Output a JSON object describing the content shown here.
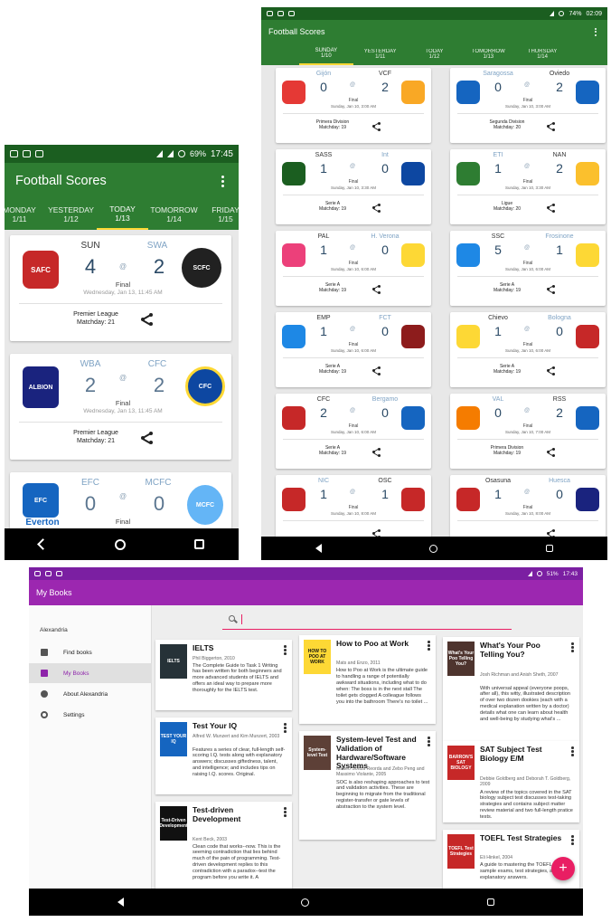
{
  "phone": {
    "status": {
      "percent": "69%",
      "time": "17:45"
    },
    "title": "Football Scores",
    "tabs": [
      {
        "day": "MONDAY",
        "date": "1/11"
      },
      {
        "day": "YESTERDAY",
        "date": "1/12"
      },
      {
        "day": "TODAY",
        "date": "1/13"
      },
      {
        "day": "TOMORROW",
        "date": "1/14"
      },
      {
        "day": "FRIDAY",
        "date": "1/15"
      }
    ],
    "matches": [
      {
        "home": "SUN",
        "away": "SWA",
        "home_score": "4",
        "away_score": "2",
        "at": "@",
        "status": "Final",
        "datetime": "Wednesday, Jan 13, 11:45 AM",
        "league": "Premier League",
        "matchday": "Matchday: 21",
        "home_color": "#c62828",
        "away_color": "#212121",
        "home_crest": "sunderland-crest",
        "away_crest": "swansea-crest"
      },
      {
        "home": "WBA",
        "away": "CFC",
        "home_score": "2",
        "away_score": "2",
        "at": "@",
        "status": "Final",
        "datetime": "Wednesday, Jan 13, 11:45 AM",
        "league": "Premier League",
        "matchday": "Matchday: 21",
        "home_color": "#1a237e",
        "away_color": "#0d47a1",
        "home_crest": "west-brom-crest",
        "away_crest": "chelsea-crest"
      },
      {
        "home": "EFC",
        "away": "MCFC",
        "home_score": "0",
        "away_score": "0",
        "at": "@",
        "status": "Final",
        "datetime": "",
        "league": "",
        "matchday": "",
        "home_color": "#1565c0",
        "away_color": "#64b5f6",
        "home_crest": "everton-crest",
        "away_crest": "man-city-crest",
        "home_label": "Everton"
      }
    ]
  },
  "tablet": {
    "status": {
      "percent": "74%",
      "time": "02:09"
    },
    "title": "Football Scores",
    "tabs": [
      {
        "day": "SUNDAY",
        "date": "1/10"
      },
      {
        "day": "YESTERDAY",
        "date": "1/11"
      },
      {
        "day": "TODAY",
        "date": "1/12"
      },
      {
        "day": "TOMORROW",
        "date": "1/13"
      },
      {
        "day": "THURSDAY",
        "date": "1/14"
      }
    ],
    "matches": [
      {
        "home": "Gijón",
        "away": "VCF",
        "home_score": "0",
        "away_score": "2",
        "status": "Final",
        "datetime": "Sunday, Jan 10, 3:00 AM",
        "league": "Primera Division",
        "matchday": "Matchday: 19",
        "home_color": "#e53935",
        "away_color": "#f9a825",
        "home_win": false
      },
      {
        "home": "Saragossa",
        "away": "Oviedo",
        "home_score": "0",
        "away_score": "2",
        "status": "Final",
        "datetime": "Sunday, Jan 10, 3:00 AM",
        "league": "Segunda Division",
        "matchday": "Matchday: 20",
        "home_color": "#1565c0",
        "away_color": "#1565c0",
        "home_win": false
      },
      {
        "home": "SASS",
        "away": "Int",
        "home_score": "1",
        "away_score": "0",
        "status": "Final",
        "datetime": "Sunday, Jan 10, 3:30 AM",
        "league": "Serie A",
        "matchday": "Matchday: 19",
        "home_color": "#1b5e20",
        "away_color": "#0d47a1",
        "home_win": true
      },
      {
        "home": "ETI",
        "away": "NAN",
        "home_score": "1",
        "away_score": "2",
        "status": "Final",
        "datetime": "Sunday, Jan 10, 3:30 AM",
        "league": "Ligue",
        "matchday": "Matchday: 20",
        "home_color": "#2e7d32",
        "away_color": "#fbc02d",
        "home_win": false
      },
      {
        "home": "PAL",
        "away": "H. Verona",
        "home_score": "1",
        "away_score": "0",
        "status": "Final",
        "datetime": "Sunday, Jan 10, 6:00 AM",
        "league": "Serie A",
        "matchday": "Matchday: 19",
        "home_color": "#ec407a",
        "away_color": "#fdd835",
        "home_win": true
      },
      {
        "home": "SSC",
        "away": "Frosinone",
        "home_score": "5",
        "away_score": "1",
        "status": "Final",
        "datetime": "Sunday, Jan 10, 6:00 AM",
        "league": "Serie A",
        "matchday": "Matchday: 19",
        "home_color": "#1e88e5",
        "away_color": "#fdd835",
        "home_win": true
      },
      {
        "home": "EMP",
        "away": "FCT",
        "home_score": "1",
        "away_score": "0",
        "status": "Final",
        "datetime": "Sunday, Jan 10, 6:00 AM",
        "league": "Serie A",
        "matchday": "Matchday: 19",
        "home_color": "#1e88e5",
        "away_color": "#8d1c1c",
        "home_win": true
      },
      {
        "home": "Chievo",
        "away": "Bologna",
        "home_score": "1",
        "away_score": "0",
        "status": "Final",
        "datetime": "Sunday, Jan 10, 6:00 AM",
        "league": "Serie A",
        "matchday": "Matchday: 19",
        "home_color": "#fdd835",
        "away_color": "#c62828",
        "home_win": true
      },
      {
        "home": "CFC",
        "away": "Bergamo",
        "home_score": "2",
        "away_score": "0",
        "status": "Final",
        "datetime": "Sunday, Jan 10, 6:00 AM",
        "league": "Serie A",
        "matchday": "Matchday: 19",
        "home_color": "#c62828",
        "away_color": "#1565c0",
        "home_win": true
      },
      {
        "home": "VAL",
        "away": "RSS",
        "home_score": "0",
        "away_score": "2",
        "status": "Final",
        "datetime": "Sunday, Jan 10, 7:00 AM",
        "league": "Primera Division",
        "matchday": "Matchday: 19",
        "home_color": "#f57c00",
        "away_color": "#1565c0",
        "home_win": false
      },
      {
        "home": "NIC",
        "away": "OSC",
        "home_score": "1",
        "away_score": "1",
        "status": "Final",
        "datetime": "Sunday, Jan 10, 8:00 AM",
        "league": "",
        "matchday": "",
        "home_color": "#c62828",
        "away_color": "#c62828",
        "home_win": false
      },
      {
        "home": "Osasuna",
        "away": "Huesca",
        "home_score": "1",
        "away_score": "0",
        "status": "Final",
        "datetime": "Sunday, Jan 10, 8:00 AM",
        "league": "",
        "matchday": "",
        "home_color": "#c62828",
        "away_color": "#1a237e",
        "home_win": true
      }
    ]
  },
  "books": {
    "status": {
      "percent": "51%",
      "time": "17:43"
    },
    "title": "My Books",
    "drawer": {
      "header": "Alexandria",
      "items": [
        {
          "label": "Find books",
          "icon": "find-books-icon"
        },
        {
          "label": "My Books",
          "icon": "my-books-icon",
          "selected": true
        },
        {
          "label": "About Alexandria",
          "icon": "info-icon"
        },
        {
          "label": "Settings",
          "icon": "settings-icon"
        }
      ]
    },
    "fab": "+",
    "list": [
      {
        "title": "IELTS",
        "author": "Phil Biggerton, 2010",
        "desc": "The Complete Guide to Task 1 Writing has been written for both beginners and more advanced students of IELTS and offers an ideal way to prepare more thoroughly for the IELTS test.",
        "cover": "IELTS",
        "cover_color": "#263238"
      },
      {
        "title": "Test Your IQ",
        "author": "Alfred W. Munzert and Kim Munzert, 2003",
        "desc": "Features a series of clear, full-length self-scoring I.Q. tests along with explanatory answers; discusses giftedness, talent, and intelligence; and includes tips on raising I.Q. scores. Original.",
        "cover": "TEST YOUR IQ",
        "cover_color": "#1565c0"
      },
      {
        "title": "Test-driven Development",
        "author": "Kent Beck, 2003",
        "desc": "Clean code that works--now. This is the seeming contradiction that lies behind much of the pain of programming. Test-driven development replies to this contradiction with a paradox--test the program before you write it. A",
        "cover": "Test-Driven Development",
        "cover_color": "#111111"
      },
      {
        "title": "How to Poo at Work",
        "author": "Mats and Enzo, 2011",
        "desc": "How to Poo at Work is the ultimate guide to handling a range of potentially awkward situations, including what to do when: The boss is in the next stall The toilet gets clogged A colleague follows you into the bathroom There's no toilet ...",
        "cover": "HOW TO POO AT WORK",
        "cover_color": "#fdd835"
      },
      {
        "title": "System-level Test and Validation of Hardware/Software Systems",
        "author": "Matteo Sonza Reorda and Zebo Peng and Massimo Violante, 2005",
        "desc": "SOC is also reshaping approaches to test and validation activities. These are beginning to migrate from the traditional register-transfer or gate levels of abstraction to the system level.",
        "cover": "System-level Test",
        "cover_color": "#5d4037"
      },
      {
        "title": "What's Your Poo Telling You?",
        "author": "Josh Richman and Anish Sheth, 2007",
        "desc": "With universal appeal (everyone poops, after all), this witty, illustrated description of over two dozen dookies (each with a medical explanation written by a doctor) details what one can learn about health and well-being by studying what's ...",
        "cover": "What's Your Poo Telling You?",
        "cover_color": "#4e342e"
      },
      {
        "title": "SAT Subject Test Biology E/M",
        "author": "Debbie Goldberg and Deborah T. Goldberg, 2009",
        "desc": "A review of the topics covered in the SAT biology subject test discusses test-taking strategies and contains subject matter review material and two full-length pratice tests.",
        "cover": "BARRON'S SAT BIOLOGY",
        "cover_color": "#c62828"
      },
      {
        "title": "TOEFL Test Strategies",
        "author": "Eli Hinkel, 2004",
        "desc": "A guide to mastering the TOEFL provides sample exams, test strategies, and explanatory answers.",
        "cover": "TOEFL Test Strategies",
        "cover_color": "#c62828"
      }
    ]
  },
  "colors": {
    "green_dark": "#1b5e20",
    "green": "#2e7d32",
    "purple_dark": "#7b1fa2",
    "purple": "#9c27b0",
    "score": "#2b4a66",
    "accent": "#fdd835"
  }
}
